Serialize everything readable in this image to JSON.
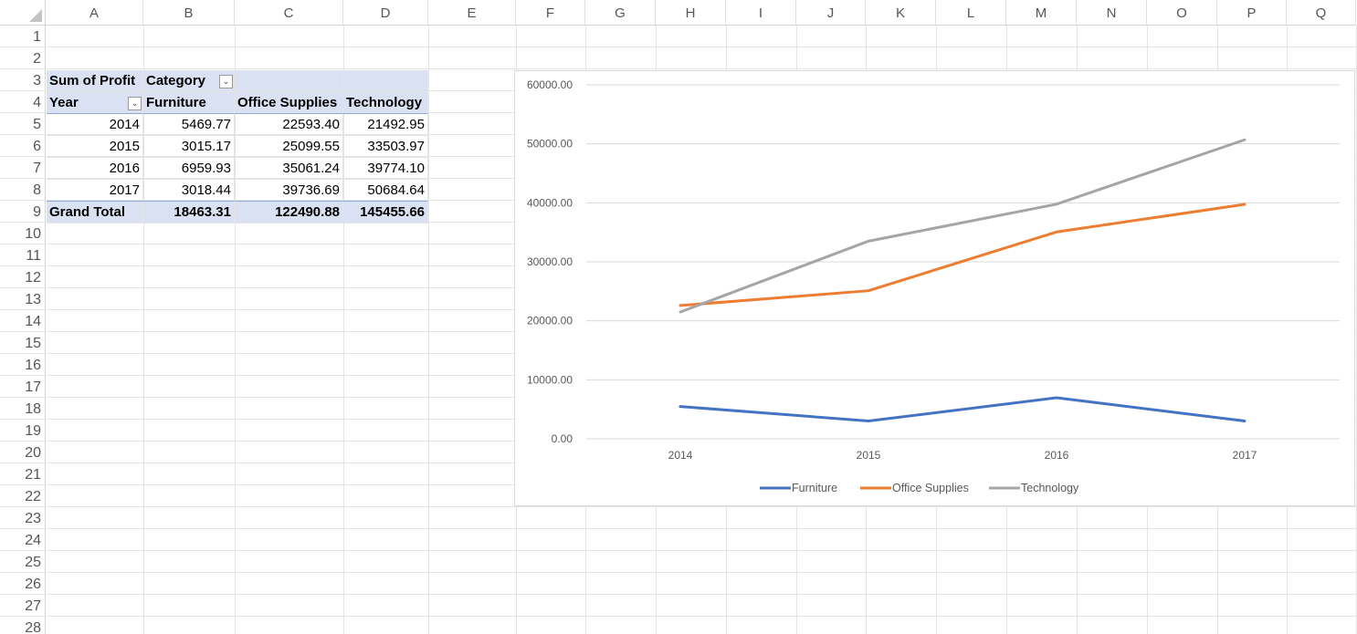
{
  "sheet": {
    "columns": [
      "A",
      "B",
      "C",
      "D",
      "E",
      "F",
      "G",
      "H",
      "I",
      "J",
      "K",
      "L",
      "M",
      "N",
      "O",
      "P",
      "Q"
    ],
    "rows": [
      "1",
      "2",
      "3",
      "4",
      "5",
      "6",
      "7",
      "8",
      "9",
      "10",
      "11",
      "12",
      "13",
      "14",
      "15",
      "16",
      "17",
      "18",
      "19",
      "20",
      "21",
      "22",
      "23",
      "24",
      "25",
      "26",
      "27",
      "28"
    ]
  },
  "pivot": {
    "value_field": "Sum of Profit",
    "column_field": "Category",
    "row_field": "Year",
    "headers": [
      "Furniture",
      "Office Supplies",
      "Technology"
    ],
    "rows": [
      {
        "year": "2014",
        "values": [
          "5469.77",
          "22593.40",
          "21492.95"
        ]
      },
      {
        "year": "2015",
        "values": [
          "3015.17",
          "25099.55",
          "33503.97"
        ]
      },
      {
        "year": "2016",
        "values": [
          "6959.93",
          "35061.24",
          "39774.10"
        ]
      },
      {
        "year": "2017",
        "values": [
          "3018.44",
          "39736.69",
          "50684.64"
        ]
      }
    ],
    "total_label": "Grand Total",
    "totals": [
      "18463.31",
      "122490.88",
      "145455.66"
    ],
    "filter_icon": "dropdown-arrow-icon"
  },
  "chart_data": {
    "type": "line",
    "categories": [
      "2014",
      "2015",
      "2016",
      "2017"
    ],
    "series": [
      {
        "name": "Furniture",
        "color": "#4472c4",
        "values": [
          5469.77,
          3015.17,
          6959.93,
          3018.44
        ]
      },
      {
        "name": "Office Supplies",
        "color": "#ed7d31",
        "values": [
          22593.4,
          25099.55,
          35061.24,
          39736.69
        ]
      },
      {
        "name": "Technology",
        "color": "#a5a5a5",
        "values": [
          21492.95,
          33503.97,
          39774.1,
          50684.64
        ]
      }
    ],
    "ylim": [
      0,
      60000
    ],
    "yticks": [
      "0.00",
      "10000.00",
      "20000.00",
      "30000.00",
      "40000.00",
      "50000.00",
      "60000.00"
    ],
    "title": "",
    "xlabel": "",
    "ylabel": "",
    "grid": true,
    "legend": "bottom"
  }
}
